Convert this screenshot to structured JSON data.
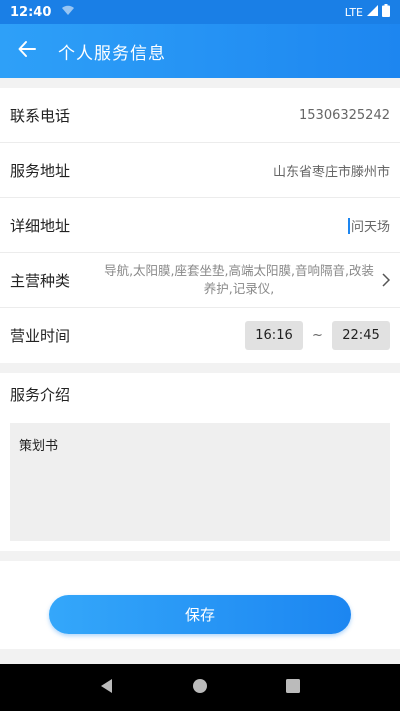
{
  "status_bar": {
    "time": "12:40",
    "network": "LTE"
  },
  "app_bar": {
    "title": "个人服务信息"
  },
  "form": {
    "phone": {
      "label": "联系电话",
      "value": "15306325242"
    },
    "address": {
      "label": "服务地址",
      "value": "山东省枣庄市滕州市"
    },
    "detail_address": {
      "label": "详细地址",
      "value": "问天场"
    },
    "category": {
      "label": "主营种类",
      "value": "导航,太阳膜,座套坐垫,高端太阳膜,音响隔音,改装养护,记录仪,"
    },
    "hours": {
      "label": "营业时间",
      "start": "16:16",
      "separator": "~",
      "end": "22:45"
    }
  },
  "intro": {
    "label": "服务介绍",
    "value": "策划书"
  },
  "save_button": {
    "label": "保存"
  },
  "colors": {
    "accent": "#1d86f0",
    "accent_light": "#34a7fa",
    "background": "#f2f2f2"
  }
}
